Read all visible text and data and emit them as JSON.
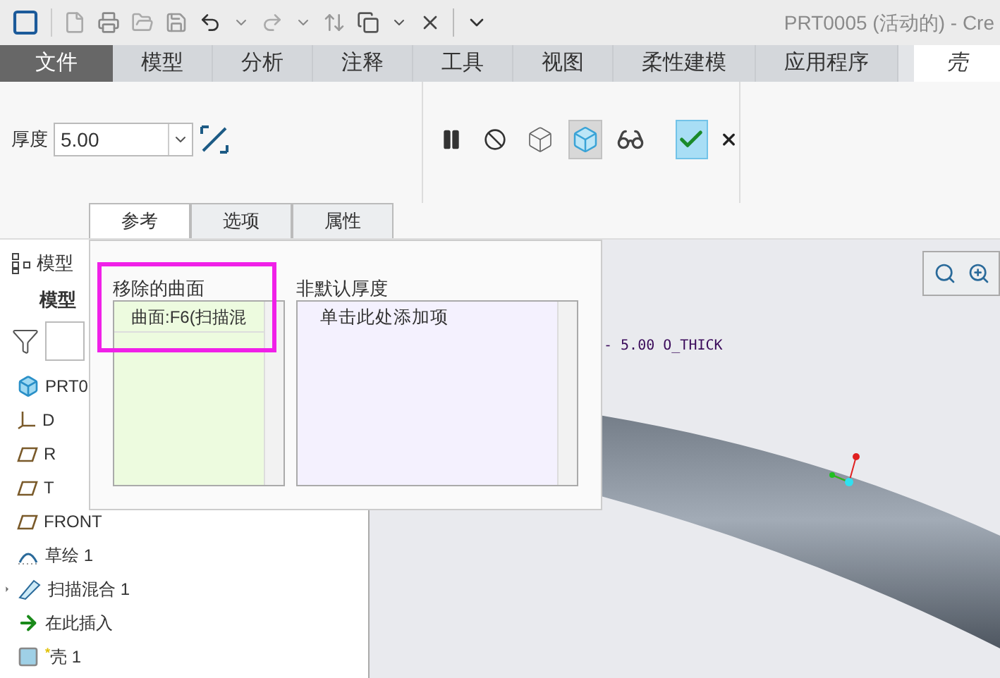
{
  "window": {
    "title": "PRT0005 (活动的) - Cre"
  },
  "ribbon_tabs": [
    {
      "label": "文件",
      "kind": "file",
      "selected": false
    },
    {
      "label": "模型",
      "kind": "tab",
      "selected": false
    },
    {
      "label": "分析",
      "kind": "tab",
      "selected": false
    },
    {
      "label": "注释",
      "kind": "tab",
      "selected": false
    },
    {
      "label": "工具",
      "kind": "tab",
      "selected": false
    },
    {
      "label": "视图",
      "kind": "tab",
      "selected": false
    },
    {
      "label": "柔性建模",
      "kind": "tab",
      "selected": false
    },
    {
      "label": "应用程序",
      "kind": "tab",
      "selected": false
    },
    {
      "label": "壳",
      "kind": "tab",
      "selected": true
    }
  ],
  "thickness": {
    "label": "厚度",
    "value": "5.00"
  },
  "tools": [
    {
      "kind": "pause",
      "selected": false
    },
    {
      "kind": "stop",
      "selected": false
    },
    {
      "kind": "wireframe",
      "selected": false
    },
    {
      "kind": "shaded",
      "selected": true
    },
    {
      "kind": "glasses",
      "selected": false
    }
  ],
  "panel_tabs": [
    {
      "label": "参考",
      "selected": true
    },
    {
      "label": "选项",
      "selected": false
    },
    {
      "label": "属性",
      "selected": false
    }
  ],
  "removed_surfaces": {
    "label": "移除的曲面",
    "items": [
      "曲面:F6(扫描混"
    ]
  },
  "non_default_thickness": {
    "label": "非默认厚度",
    "items": [
      "单击此处添加项"
    ]
  },
  "model_tree": {
    "title": "模型",
    "subtitle": "模型",
    "items": [
      {
        "label": "PRT0",
        "kind": "part"
      },
      {
        "label": "D",
        "kind": "csys"
      },
      {
        "label": "R",
        "kind": "plane"
      },
      {
        "label": "T",
        "kind": "plane"
      },
      {
        "label": "FRONT",
        "kind": "plane"
      },
      {
        "label": "草绘 1",
        "kind": "sketch"
      },
      {
        "label": "扫描混合 1",
        "kind": "sweep",
        "expanded": false
      },
      {
        "label": "在此插入",
        "kind": "insert"
      },
      {
        "label": "壳 1",
        "kind": "shell",
        "prefix": "*"
      }
    ]
  },
  "viewport": {
    "dimension_label": "- 5.00 O_THICK"
  }
}
